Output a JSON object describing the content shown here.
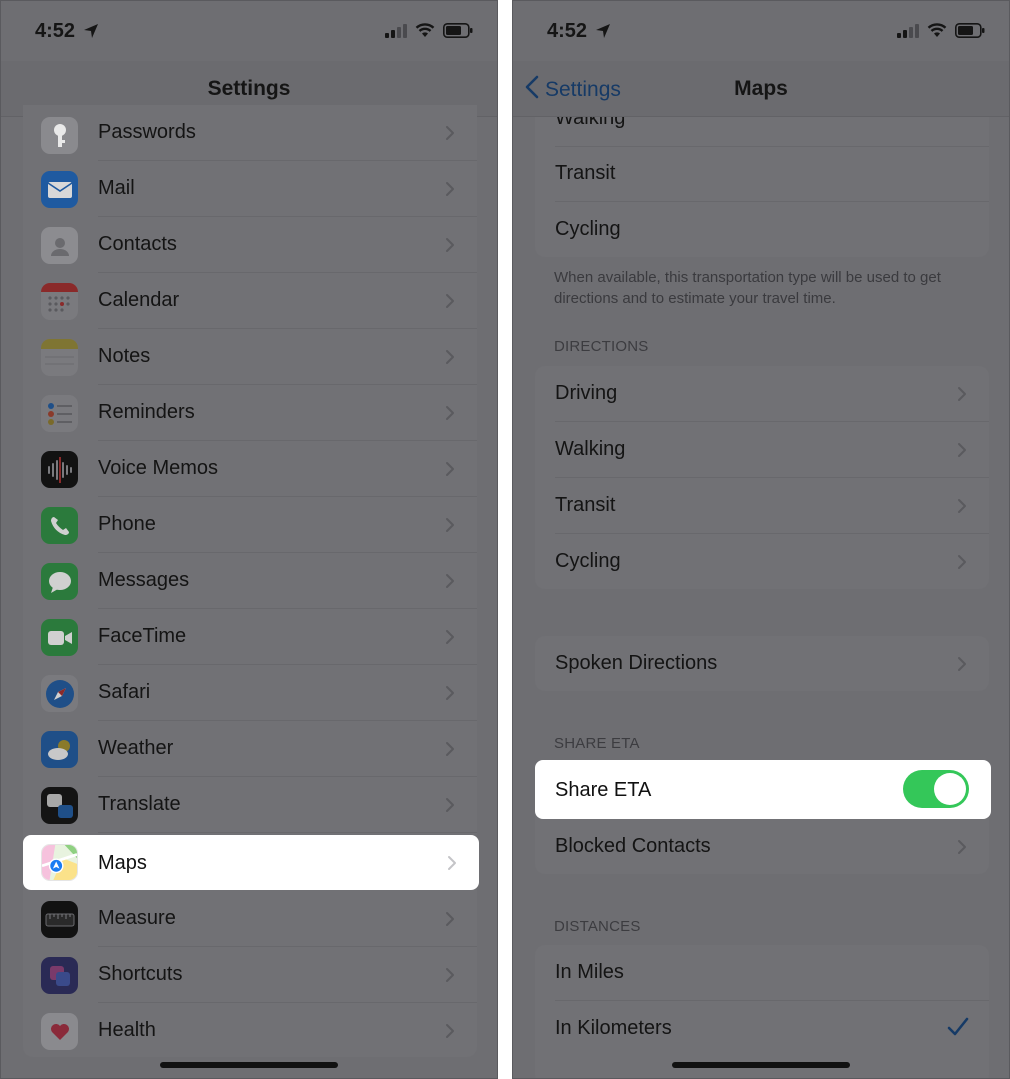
{
  "left": {
    "status": {
      "time": "4:52"
    },
    "nav": {
      "title": "Settings"
    },
    "items": [
      {
        "label": "Passwords",
        "icon": "key-icon"
      },
      {
        "label": "Mail",
        "icon": "mail-icon"
      },
      {
        "label": "Contacts",
        "icon": "contacts-icon"
      },
      {
        "label": "Calendar",
        "icon": "calendar-icon"
      },
      {
        "label": "Notes",
        "icon": "notes-icon"
      },
      {
        "label": "Reminders",
        "icon": "reminders-icon"
      },
      {
        "label": "Voice Memos",
        "icon": "voice-memos-icon"
      },
      {
        "label": "Phone",
        "icon": "phone-icon"
      },
      {
        "label": "Messages",
        "icon": "messages-icon"
      },
      {
        "label": "FaceTime",
        "icon": "facetime-icon"
      },
      {
        "label": "Safari",
        "icon": "safari-icon"
      },
      {
        "label": "Weather",
        "icon": "weather-icon"
      },
      {
        "label": "Translate",
        "icon": "translate-icon"
      },
      {
        "label": "Maps",
        "icon": "maps-icon",
        "highlighted": true
      },
      {
        "label": "Measure",
        "icon": "measure-icon"
      },
      {
        "label": "Shortcuts",
        "icon": "shortcuts-icon"
      },
      {
        "label": "Health",
        "icon": "health-icon"
      }
    ]
  },
  "right": {
    "status": {
      "time": "4:52"
    },
    "nav": {
      "back_label": "Settings",
      "title": "Maps"
    },
    "transport": {
      "partial_label": "Walking",
      "items": [
        "Transit",
        "Cycling"
      ],
      "footer": "When available, this transportation type will be used to get directions and to estimate your travel time."
    },
    "directions": {
      "header": "DIRECTIONS",
      "items": [
        "Driving",
        "Walking",
        "Transit",
        "Cycling"
      ]
    },
    "spoken": {
      "label": "Spoken Directions"
    },
    "share_eta": {
      "header": "SHARE ETA",
      "toggle_label": "Share ETA",
      "toggle_on": true,
      "blocked_label": "Blocked Contacts"
    },
    "distances": {
      "header": "DISTANCES",
      "items": [
        "In Miles",
        "In Kilometers"
      ],
      "selected": "In Kilometers"
    }
  },
  "colors": {
    "dim_background": "#6e6e72",
    "highlight": "#ffffff",
    "toggle_on": "#34c759",
    "link_blue": "#163a66"
  }
}
